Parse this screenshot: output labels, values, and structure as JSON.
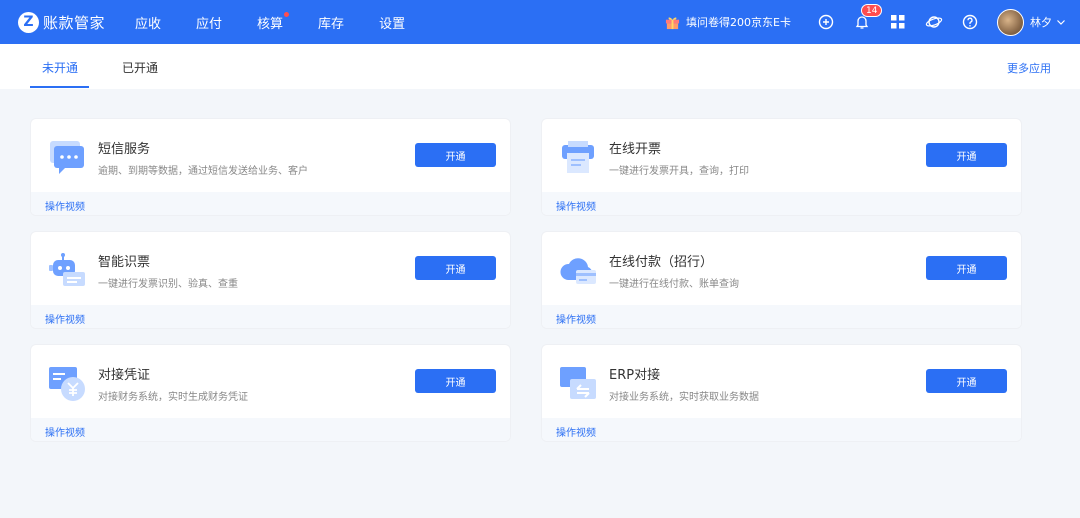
{
  "app": {
    "logo_letter": "Z",
    "name": "账款管家"
  },
  "nav": {
    "items": [
      {
        "label": "应收"
      },
      {
        "label": "应付"
      },
      {
        "label": "核算"
      },
      {
        "label": "库存"
      },
      {
        "label": "设置"
      }
    ]
  },
  "header": {
    "promo_text": "填问卷得200京东E卡",
    "notification_count": "14",
    "user_name": "林夕"
  },
  "tabs": {
    "items": [
      {
        "label": "未开通"
      },
      {
        "label": "已开通"
      }
    ],
    "active": "未开通",
    "more_apps": "更多应用"
  },
  "cards": [
    {
      "title": "短信服务",
      "desc": "逾期、到期等数据，通过短信发送给业务、客户",
      "button": "开通",
      "footer_link": "操作视频",
      "icon": "sms-icon"
    },
    {
      "title": "在线开票",
      "desc": "一键进行发票开具，查询，打印",
      "button": "开通",
      "footer_link": "操作视频",
      "icon": "invoice-print-icon"
    },
    {
      "title": "智能识票",
      "desc": "一键进行发票识别、验真、查重",
      "button": "开通",
      "footer_link": "操作视频",
      "icon": "robot-icon"
    },
    {
      "title": "在线付款（招行）",
      "desc": "一键进行在线付款、账单查询",
      "button": "开通",
      "footer_link": "操作视频",
      "icon": "cloud-card-icon"
    },
    {
      "title": "对接凭证",
      "desc": "对接财务系统，实时生成财务凭证",
      "button": "开通",
      "footer_link": "操作视频",
      "icon": "voucher-icon"
    },
    {
      "title": "ERP对接",
      "desc": "对接业务系统，实时获取业务数据",
      "button": "开通",
      "footer_link": "操作视频",
      "icon": "erp-icon"
    }
  ],
  "colors": {
    "primary": "#2b6ff4",
    "badge": "#ff4d4f",
    "page_bg": "#f3f6fa"
  }
}
